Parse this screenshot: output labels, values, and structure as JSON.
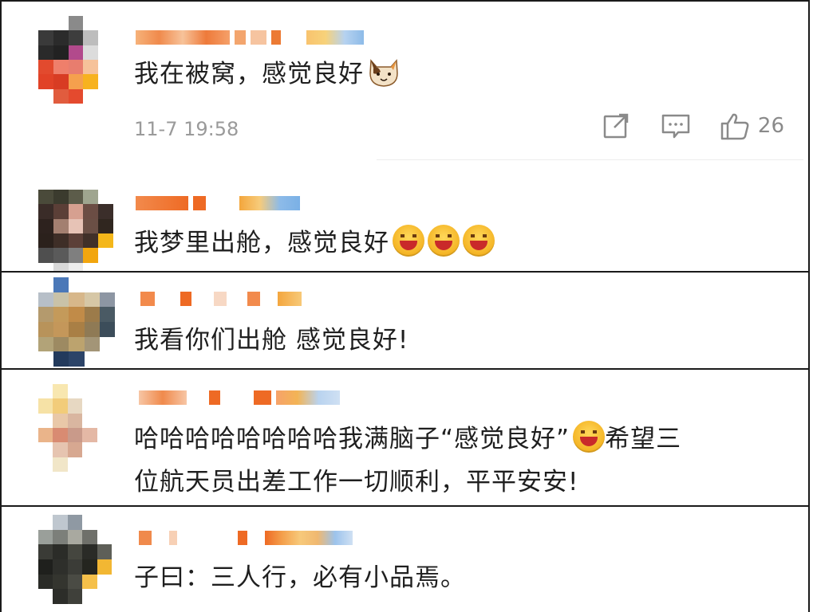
{
  "colors": {
    "text": "#1f1f1f",
    "meta": "#9a9a9a",
    "icon": "#8a8a8a",
    "panel_border": "#1a1a1a",
    "emoji_face": "#f4b323"
  },
  "comments": [
    {
      "text": "我在被窝，感觉良好",
      "emoji": [
        "cat-emoji"
      ],
      "timestamp": "11-7 19:58",
      "like_count": "26",
      "actions": [
        "share-icon",
        "comment-icon",
        "thumbs-up-icon"
      ]
    },
    {
      "text": "我梦里出舱，感觉良好",
      "emoji": [
        "laughing-emoji",
        "laughing-emoji",
        "laughing-emoji"
      ]
    },
    {
      "text": "我看你们出舱 感觉良好!"
    },
    {
      "text_line1_before": "哈哈哈哈哈哈哈哈我满脑子“感觉良好”",
      "text_line1_after": "希望三",
      "text_line2": "位航天员出差工作一切顺利，平平安安!",
      "emoji": [
        "laughing-emoji"
      ]
    },
    {
      "text": "子曰：三人行，必有小品焉。"
    }
  ]
}
